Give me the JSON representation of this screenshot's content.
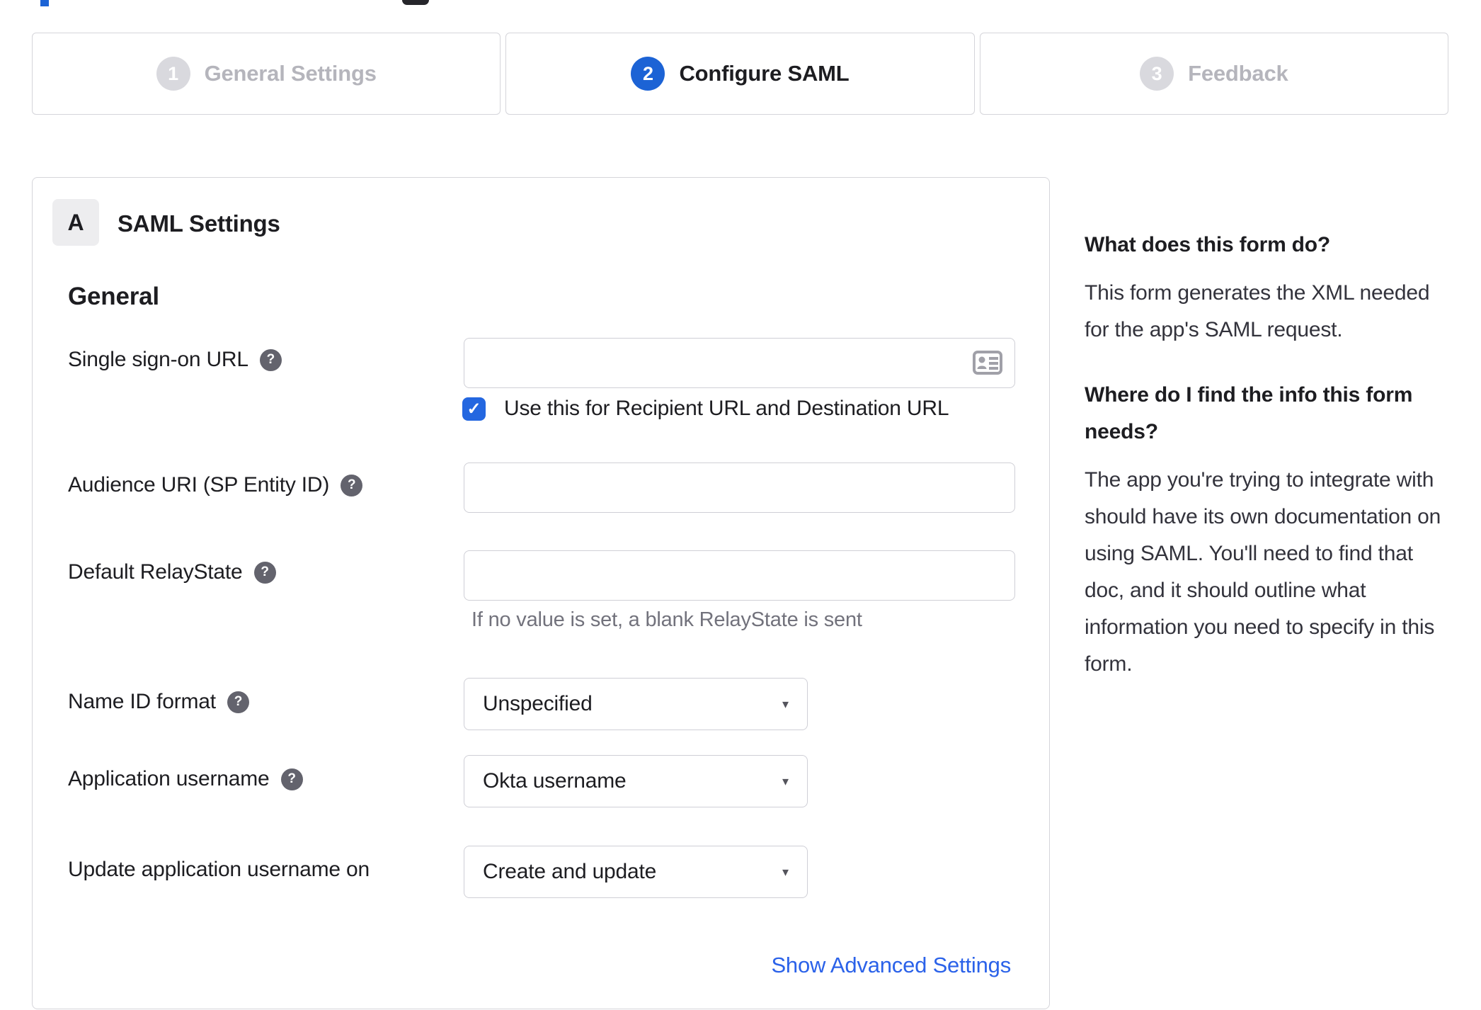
{
  "stepper": {
    "steps": [
      {
        "number": "1",
        "label": "General Settings",
        "state": "inactive"
      },
      {
        "number": "2",
        "label": "Configure SAML",
        "state": "active"
      },
      {
        "number": "3",
        "label": "Feedback",
        "state": "inactive"
      }
    ]
  },
  "panel": {
    "badge": "A",
    "title": "SAML Settings",
    "section_heading": "General",
    "fields": [
      {
        "label": "Single sign-on URL",
        "type": "text",
        "value": "",
        "checkbox": {
          "checked": true,
          "label": "Use this for Recipient URL and Destination URL"
        }
      },
      {
        "label": "Audience URI (SP Entity ID)",
        "type": "text",
        "value": ""
      },
      {
        "label": "Default RelayState",
        "type": "text",
        "value": "",
        "helper": "If no value is set, a blank RelayState is sent"
      },
      {
        "label": "Name ID format",
        "type": "select",
        "value": "Unspecified"
      },
      {
        "label": "Application username",
        "type": "select",
        "value": "Okta username"
      },
      {
        "label": "Update application username on",
        "type": "select",
        "value": "Create and update"
      }
    ],
    "advanced_link": "Show Advanced Settings"
  },
  "sidebar": {
    "sections": [
      {
        "heading": "What does this form do?",
        "body": "This form generates the XML needed for the app's SAML request."
      },
      {
        "heading": "Where do I find the info this form needs?",
        "body": "The app you're trying to integrate with should have its own documentation on using SAML. You'll need to find that doc, and it should outline what information you need to specify in this form."
      }
    ]
  },
  "icons": {
    "help_glyph": "?",
    "check_glyph": "✓",
    "arrow_glyph": "▾"
  },
  "colors": {
    "accent_blue": "#1c63d5",
    "checkbox_blue": "#2467e0",
    "link_blue": "#2b62e9",
    "border_grey": "#d5d5da",
    "text_dark": "#1d1d21",
    "text_grey": "#72727c",
    "inactive_badge": "#d9d9de"
  }
}
